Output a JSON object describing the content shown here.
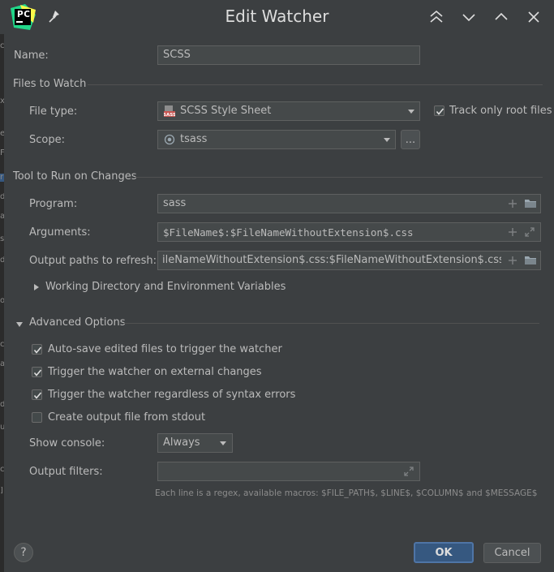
{
  "window": {
    "title": "Edit Watcher",
    "logo_text": "PC",
    "icons": [
      "pycharm-logo",
      "pin-icon",
      "chevron-double-up-icon",
      "chevron-down-icon",
      "chevron-up-icon",
      "close-icon"
    ]
  },
  "left_strip_glyphs": [
    "c",
    "x",
    "e",
    "F",
    "r",
    "d",
    "a",
    "s",
    "d",
    "o",
    "c",
    "a",
    "d",
    "u",
    "c",
    "]"
  ],
  "name_row": {
    "label": "Name:",
    "value": "SCSS"
  },
  "files_to_watch": {
    "section_label": "Files to Watch",
    "file_type_label": "File type:",
    "file_type_value": "SCSS Style Sheet",
    "file_type_icon": "sass-file-icon",
    "track_root_label": "Track only root files",
    "track_root_checked": true,
    "scope_label": "Scope:",
    "scope_value": "tsass",
    "scope_icon": "scope-icon",
    "scope_more_label": "..."
  },
  "tool_to_run": {
    "section_label": "Tool to Run on Changes",
    "program_label": "Program:",
    "program_value": "sass",
    "arguments_label": "Arguments:",
    "arguments_value": "$FileName$:$FileNameWithoutExtension$.css",
    "output_label": "Output paths to refresh:",
    "output_value": "ileNameWithoutExtension$.css:$FileNameWithoutExtension$.css.map",
    "working_dir_label": "Working Directory and Environment Variables"
  },
  "advanced": {
    "section_label": "Advanced Options",
    "options": [
      {
        "label": "Auto-save edited files to trigger the watcher",
        "checked": true
      },
      {
        "label": "Trigger the watcher on external changes",
        "checked": true
      },
      {
        "label": "Trigger the watcher regardless of syntax errors",
        "checked": true
      },
      {
        "label": "Create output file from stdout",
        "checked": false
      }
    ],
    "show_console_label": "Show console:",
    "show_console_value": "Always",
    "output_filters_label": "Output filters:",
    "output_filters_value": "",
    "hint": "Each line is a regex, available macros: $FILE_PATH$, $LINE$, $COLUMN$ and $MESSAGE$"
  },
  "footer": {
    "help_label": "?",
    "ok_label": "OK",
    "cancel_label": "Cancel"
  },
  "colors": {
    "background": "#3c3f41",
    "field_bg": "#45494a",
    "field_border": "#5e6060",
    "text": "#bbbbbb",
    "ok_bg": "#365880",
    "ok_border": "#4f75a6",
    "logo_green": "#21d789",
    "logo_yellow": "#fcf84a"
  }
}
